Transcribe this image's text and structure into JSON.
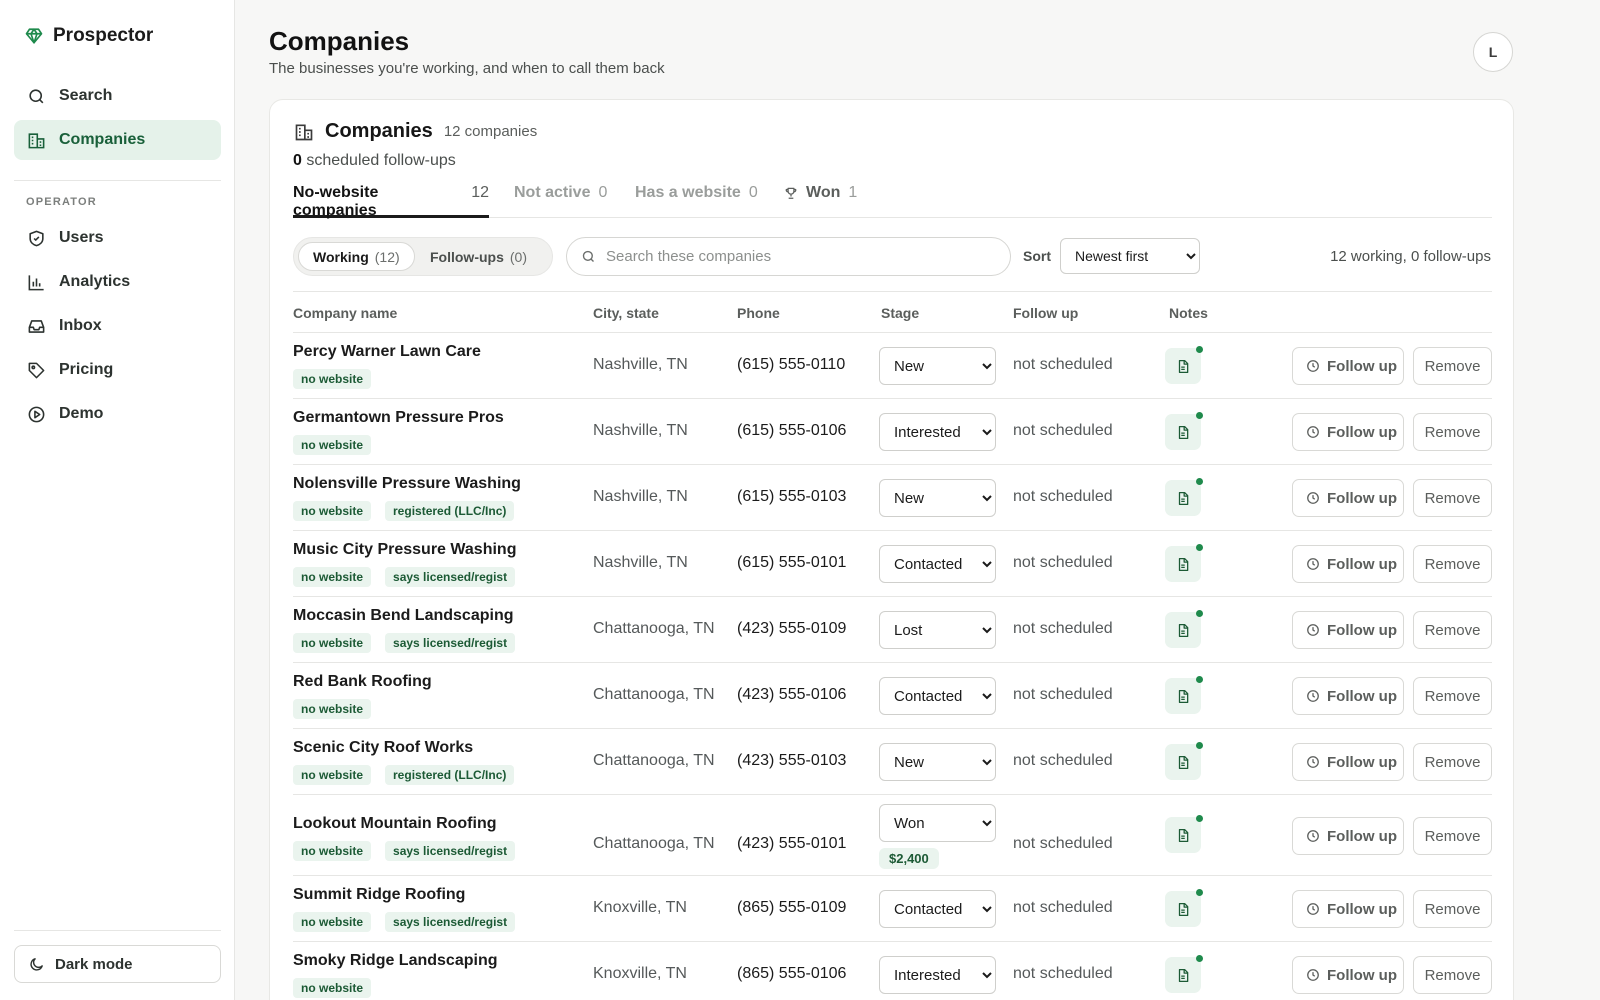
{
  "app": {
    "name": "Prospector"
  },
  "sidebar": {
    "nav": [
      {
        "label": "Search",
        "icon": "search-icon"
      },
      {
        "label": "Companies",
        "icon": "building-icon",
        "active": true
      }
    ],
    "section_label": "OPERATOR",
    "operator": [
      {
        "label": "Users",
        "icon": "shield-icon"
      },
      {
        "label": "Analytics",
        "icon": "bar-chart-icon"
      },
      {
        "label": "Inbox",
        "icon": "inbox-icon"
      },
      {
        "label": "Pricing",
        "icon": "tag-icon"
      },
      {
        "label": "Demo",
        "icon": "play-circle-icon"
      }
    ],
    "dark_mode_label": "Dark mode"
  },
  "header": {
    "title": "Companies",
    "subtitle": "The businesses you're working, and when to call them back",
    "avatar_initial": "L"
  },
  "card": {
    "title": "Companies",
    "count_label": "12 companies",
    "scheduled_count": "0",
    "scheduled_label": "scheduled follow-ups",
    "tabs": [
      {
        "label": "No-website companies",
        "count": "12"
      },
      {
        "label": "Not active",
        "count": "0"
      },
      {
        "label": "Has a website",
        "count": "0"
      },
      {
        "label": "Won",
        "count": "1"
      }
    ],
    "segments": [
      {
        "label": "Working",
        "count": "(12)"
      },
      {
        "label": "Follow-ups",
        "count": "(0)"
      }
    ],
    "search_placeholder": "Search these companies",
    "sort_label": "Sort",
    "sort_value": "Newest first",
    "summary": "12 working, 0 follow-ups"
  },
  "table": {
    "headers": {
      "company": "Company name",
      "city": "City, state",
      "phone": "Phone",
      "stage": "Stage",
      "follow": "Follow up",
      "notes": "Notes"
    },
    "follow_up_button": "Follow up",
    "remove_button": "Remove",
    "rows": [
      {
        "name": "Percy Warner Lawn Care",
        "badges": [
          "no website"
        ],
        "city": "Nashville, TN",
        "phone": "(615) 555-0110",
        "stage": "New",
        "follow": "not scheduled"
      },
      {
        "name": "Germantown Pressure Pros",
        "badges": [
          "no website"
        ],
        "city": "Nashville, TN",
        "phone": "(615) 555-0106",
        "stage": "Interested",
        "follow": "not scheduled"
      },
      {
        "name": "Nolensville Pressure Washing",
        "badges": [
          "no website",
          "registered (LLC/Inc)"
        ],
        "city": "Nashville, TN",
        "phone": "(615) 555-0103",
        "stage": "New",
        "follow": "not scheduled"
      },
      {
        "name": "Music City Pressure Washing",
        "badges": [
          "no website",
          "says licensed/regist"
        ],
        "city": "Nashville, TN",
        "phone": "(615) 555-0101",
        "stage": "Contacted",
        "follow": "not scheduled"
      },
      {
        "name": "Moccasin Bend Landscaping",
        "badges": [
          "no website",
          "says licensed/regist"
        ],
        "city": "Chattanooga, TN",
        "phone": "(423) 555-0109",
        "stage": "Lost",
        "follow": "not scheduled"
      },
      {
        "name": "Red Bank Roofing",
        "badges": [
          "no website"
        ],
        "city": "Chattanooga, TN",
        "phone": "(423) 555-0106",
        "stage": "Contacted",
        "follow": "not scheduled"
      },
      {
        "name": "Scenic City Roof Works",
        "badges": [
          "no website",
          "registered (LLC/Inc)"
        ],
        "city": "Chattanooga, TN",
        "phone": "(423) 555-0103",
        "stage": "New",
        "follow": "not scheduled"
      },
      {
        "name": "Lookout Mountain Roofing",
        "badges": [
          "no website",
          "says licensed/regist"
        ],
        "city": "Chattanooga, TN",
        "phone": "(423) 555-0101",
        "stage": "Won",
        "amount": "$2,400",
        "follow": "not scheduled"
      },
      {
        "name": "Summit Ridge Roofing",
        "badges": [
          "no website",
          "says licensed/regist"
        ],
        "city": "Knoxville, TN",
        "phone": "(865) 555-0109",
        "stage": "Contacted",
        "follow": "not scheduled"
      },
      {
        "name": "Smoky Ridge Landscaping",
        "badges": [
          "no website"
        ],
        "city": "Knoxville, TN",
        "phone": "(865) 555-0106",
        "stage": "Interested",
        "follow": "not scheduled"
      }
    ]
  },
  "colors": {
    "accent": "#19603a",
    "accent_bg": "#e5f2ea",
    "dot": "#1f8a4c"
  }
}
